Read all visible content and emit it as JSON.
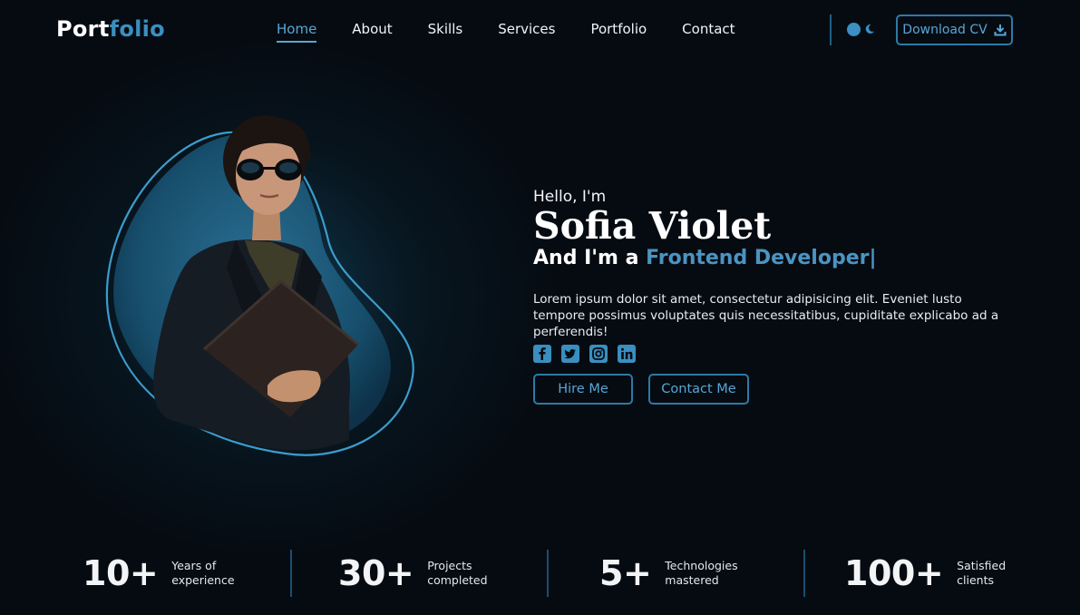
{
  "header": {
    "logo_part1": "Port",
    "logo_part2": "folio",
    "nav": [
      {
        "label": "Home",
        "active": true
      },
      {
        "label": "About"
      },
      {
        "label": "Skills"
      },
      {
        "label": "Services"
      },
      {
        "label": "Portfolio"
      },
      {
        "label": "Contact"
      }
    ],
    "download_label": "Download CV",
    "download_icon": "download-icon",
    "theme_icon": "moon-icon"
  },
  "hero": {
    "greeting": "Hello, I'm",
    "name": "Sofia Violet",
    "role_prefix": "And I'm a ",
    "role": "Frontend Developer",
    "cursor": "|",
    "description": "Lorem ipsum dolor sit amet, consectetur adipisicing elit. Eveniet lusto tempore possimus voluptates quis necessitatibus, cupiditate explicabo ad a perferendis!",
    "socials": [
      "facebook-icon",
      "twitter-icon",
      "instagram-icon",
      "linkedin-icon"
    ],
    "hire_label": "Hire Me",
    "contact_label": "Contact Me"
  },
  "stats": [
    {
      "value": "10+",
      "line1": "Years of",
      "line2": "experience"
    },
    {
      "value": "30+",
      "line1": "Projects",
      "line2": "completed"
    },
    {
      "value": "5+",
      "line1": "Technologies",
      "line2": "mastered"
    },
    {
      "value": "100+",
      "line1": "Satisfied",
      "line2": "clients"
    }
  ],
  "colors": {
    "accent": "#3a8fbf",
    "accent_light": "#58a6d4",
    "background": "#060b12"
  }
}
